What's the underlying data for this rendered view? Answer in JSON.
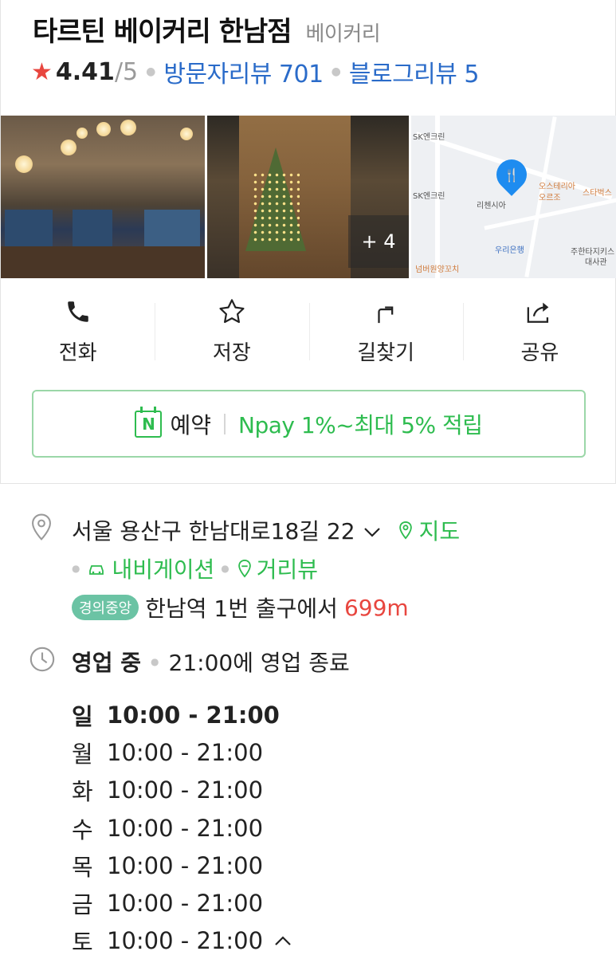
{
  "place": {
    "name": "타르틴 베이커리 한남점",
    "category": "베이커리",
    "rating": "4.41",
    "rating_max": "/5",
    "visitor_reviews": "방문자리뷰 701",
    "blog_reviews": "블로그리뷰 5"
  },
  "photos": {
    "more_count": "+ 4",
    "map_labels": [
      "SK엔크린",
      "SK엔크린",
      "오스테리아",
      "오르조",
      "스타벅스",
      "리첸시아",
      "우리은행",
      "주한타지키스",
      "대사관",
      "넘버원양꼬치"
    ]
  },
  "actions": [
    {
      "label": "전화",
      "icon": "phone-icon"
    },
    {
      "label": "저장",
      "icon": "star-icon"
    },
    {
      "label": "길찾기",
      "icon": "directions-icon"
    },
    {
      "label": "공유",
      "icon": "share-icon"
    }
  ],
  "reservation": {
    "badge": "N",
    "label": "예약",
    "npay": "Npay 1%~최대 5% 적립"
  },
  "address": {
    "text": "서울 용산구 한남대로18길 22",
    "map_link": "지도",
    "navigation_link": "내비게이션",
    "streetview_link": "거리뷰",
    "subway_line": "경의중앙",
    "subway_text": "한남역 1번 출구에서",
    "distance": "699m"
  },
  "hours": {
    "status": "영업 중",
    "closing": "21:00에 영업 종료",
    "schedule": [
      {
        "day": "일",
        "time": "10:00 - 21:00"
      },
      {
        "day": "월",
        "time": "10:00 - 21:00"
      },
      {
        "day": "화",
        "time": "10:00 - 21:00"
      },
      {
        "day": "수",
        "time": "10:00 - 21:00"
      },
      {
        "day": "목",
        "time": "10:00 - 21:00"
      },
      {
        "day": "금",
        "time": "10:00 - 21:00"
      },
      {
        "day": "토",
        "time": "10:00 - 21:00"
      }
    ]
  },
  "colors": {
    "review_blue": "#2a6bc9",
    "green": "#2ebc4f",
    "star_red": "#e8463f",
    "distance_red": "#e8463f"
  }
}
